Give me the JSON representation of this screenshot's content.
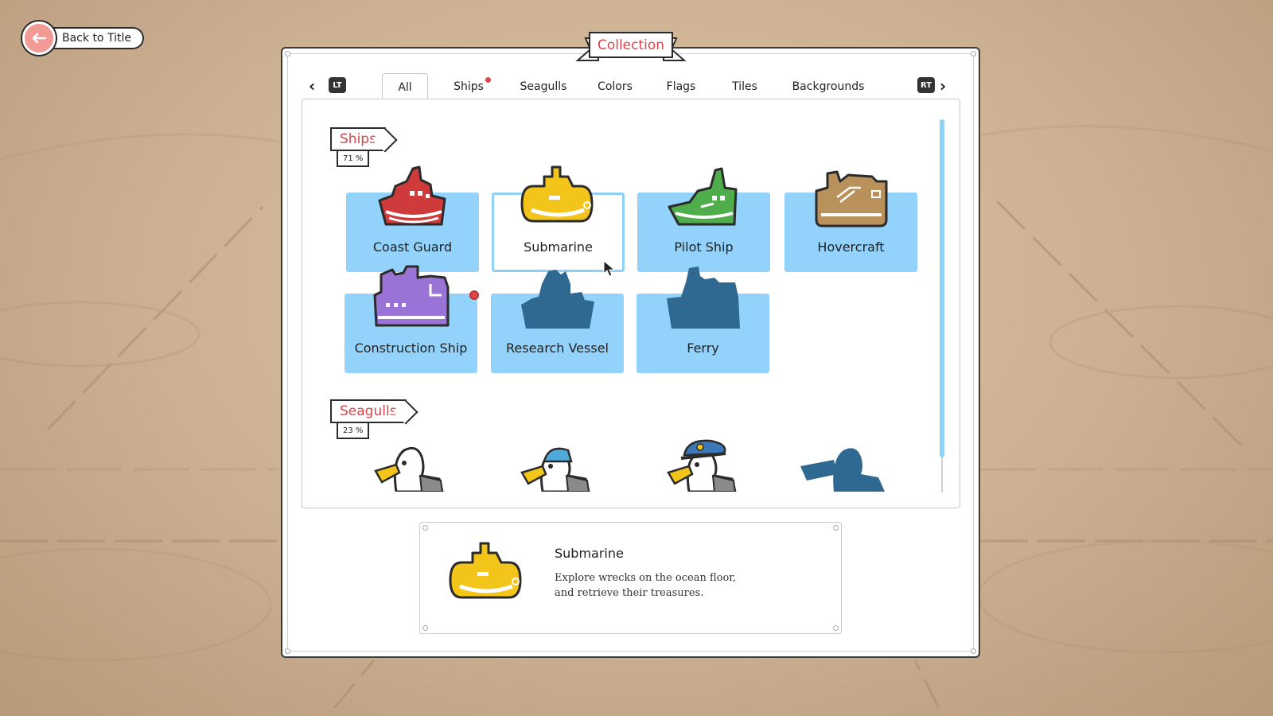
{
  "back_button": {
    "label": "Back to Title",
    "icon": "arrow-left-icon"
  },
  "title": "Collection",
  "tabs": [
    {
      "label": "All",
      "active": true,
      "new": false
    },
    {
      "label": "Ships",
      "active": false,
      "new": true
    },
    {
      "label": "Seagulls",
      "active": false,
      "new": false
    },
    {
      "label": "Colors",
      "active": false,
      "new": false
    },
    {
      "label": "Flags",
      "active": false,
      "new": false
    },
    {
      "label": "Tiles",
      "active": false,
      "new": false
    },
    {
      "label": "Backgrounds",
      "active": false,
      "new": false
    }
  ],
  "triggers": {
    "left": "LT",
    "right": "RT"
  },
  "sections": {
    "ships": {
      "title": "Ships",
      "percent": "71 %",
      "items": [
        {
          "name": "Coast Guard",
          "color": "#cf3a3a",
          "unlocked": true,
          "selected": false,
          "new": false
        },
        {
          "name": "Submarine",
          "color": "#f3c51a",
          "unlocked": true,
          "selected": true,
          "new": false
        },
        {
          "name": "Pilot Ship",
          "color": "#4fae4b",
          "unlocked": true,
          "selected": false,
          "new": false
        },
        {
          "name": "Hovercraft",
          "color": "#b8925a",
          "unlocked": true,
          "selected": false,
          "new": false
        },
        {
          "name": "Construction Ship",
          "color": "#9a73d6",
          "unlocked": true,
          "selected": false,
          "new": true
        },
        {
          "name": "Research Vessel",
          "color": "#2f6890",
          "unlocked": false,
          "selected": false,
          "new": false
        },
        {
          "name": "Ferry",
          "color": "#2f6890",
          "unlocked": false,
          "selected": false,
          "new": false
        }
      ]
    },
    "seagulls": {
      "title": "Seagulls",
      "percent": "23 %"
    }
  },
  "detail": {
    "name": "Submarine",
    "description_line1": "Explore wrecks on the ocean floor,",
    "description_line2": "and retrieve their treasures.",
    "color": "#f3c51a"
  },
  "colors": {
    "accent": "#d9464b",
    "card": "#93d3fb",
    "locked": "#2f6890"
  }
}
